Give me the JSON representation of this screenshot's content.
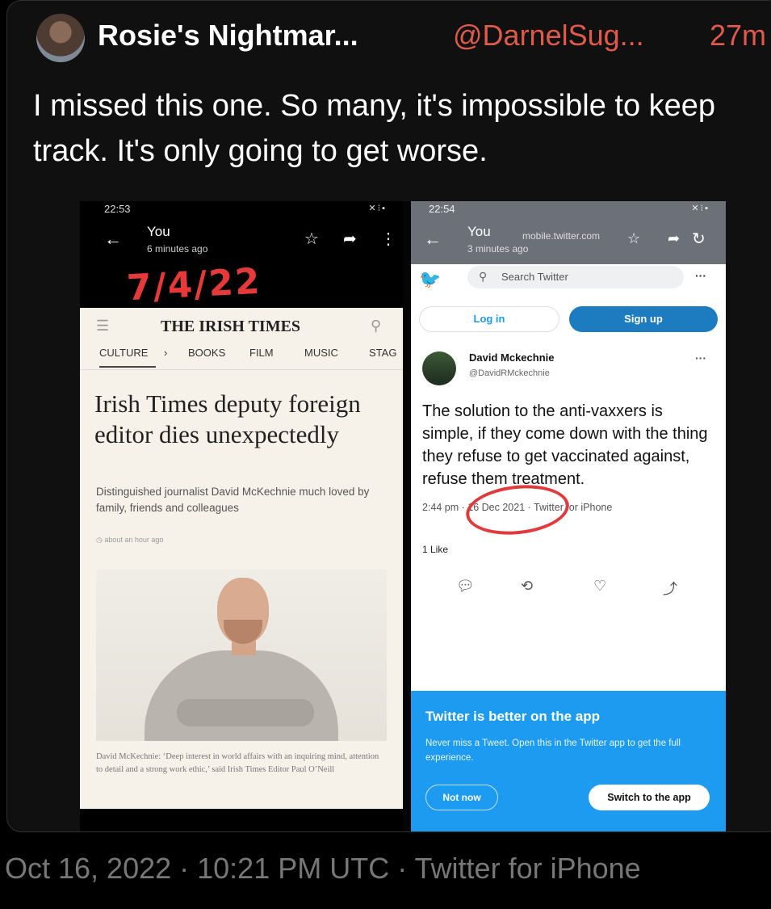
{
  "tweet": {
    "author": "Rosie's Nightmar...",
    "handle": "@DarnelSug...",
    "time_ago": "27m",
    "text": "I missed this one. So many, it's impossible to keep track. It's only going to get worse.",
    "footer": "Oct 16, 2022 · 10:21 PM UTC · Twitter for iPhone"
  },
  "left_screenshot": {
    "status_time": "22:53",
    "back_icon": "back-arrow-icon",
    "you": "You",
    "subtitle": "6 minutes ago",
    "handwritten_date": "7/4/22",
    "publication": "THE IRISH TIMES",
    "sections": [
      "CULTURE",
      "›",
      "BOOKS",
      "FILM",
      "MUSIC",
      "STAG"
    ],
    "headline": "Irish Times deputy foreign editor dies unexpectedly",
    "standfirst": "Distinguished journalist David McKechnie much loved by family, friends and colleagues",
    "published": "about an hour ago",
    "caption": "David McKechnie: ‘Deep interest in world affairs with an inquiring mind, attention to detail and a strong work ethic,’ said Irish Times Editor Paul O’Neill"
  },
  "right_screenshot": {
    "status_time": "22:54",
    "you": "You",
    "subtitle": "3 minutes ago",
    "url": "mobile.twitter.com",
    "search_placeholder": "Search Twitter",
    "login": "Log in",
    "signup": "Sign up",
    "name": "David Mckechnie",
    "handle": "@DavidRMckechnie",
    "body": "The solution to the anti-vaxxers is simple, if they come down with the thing they refuse to get vaccinated against, refuse them treatment.",
    "meta": "2:44 pm · 16 Dec 2021 · Twitter for iPhone",
    "likes": "1 Like",
    "promo_title": "Twitter is better on the app",
    "promo_sub": "Never miss a Tweet. Open this in the Twitter app to get the full experience.",
    "not_now": "Not now",
    "switch": "Switch to the app"
  },
  "colors": {
    "handle_red": "#e05a4a",
    "twitter_blue": "#1d9bf0"
  }
}
